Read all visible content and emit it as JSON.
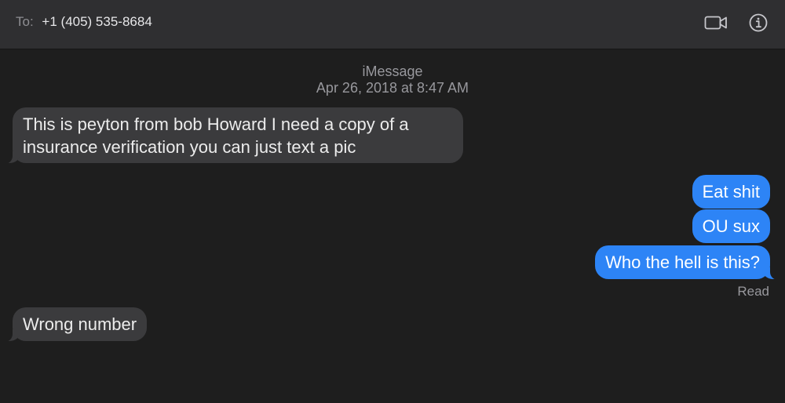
{
  "header": {
    "to_label": "To:",
    "recipient": "+1 (405) 535-8684",
    "video_icon": "video-camera-icon",
    "info_icon": "info-icon"
  },
  "conversation": {
    "service": "iMessage",
    "timestamp": "Apr 26, 2018 at 8:47 AM",
    "messages": [
      {
        "direction": "incoming",
        "text": "This is peyton from bob Howard I need a copy of a insurance verification you can just text a pic"
      },
      {
        "direction": "outgoing",
        "text": "Eat shit"
      },
      {
        "direction": "outgoing",
        "text": "OU sux"
      },
      {
        "direction": "outgoing",
        "text": "Who the hell is this?"
      },
      {
        "direction": "incoming",
        "text": "Wrong number"
      }
    ],
    "read_receipt": "Read"
  },
  "colors": {
    "background": "#1e1e1e",
    "header": "#2f2f31",
    "incoming_bubble": "#3b3b3d",
    "outgoing_bubble": "#2d84f6",
    "secondary_text": "#98989d"
  }
}
